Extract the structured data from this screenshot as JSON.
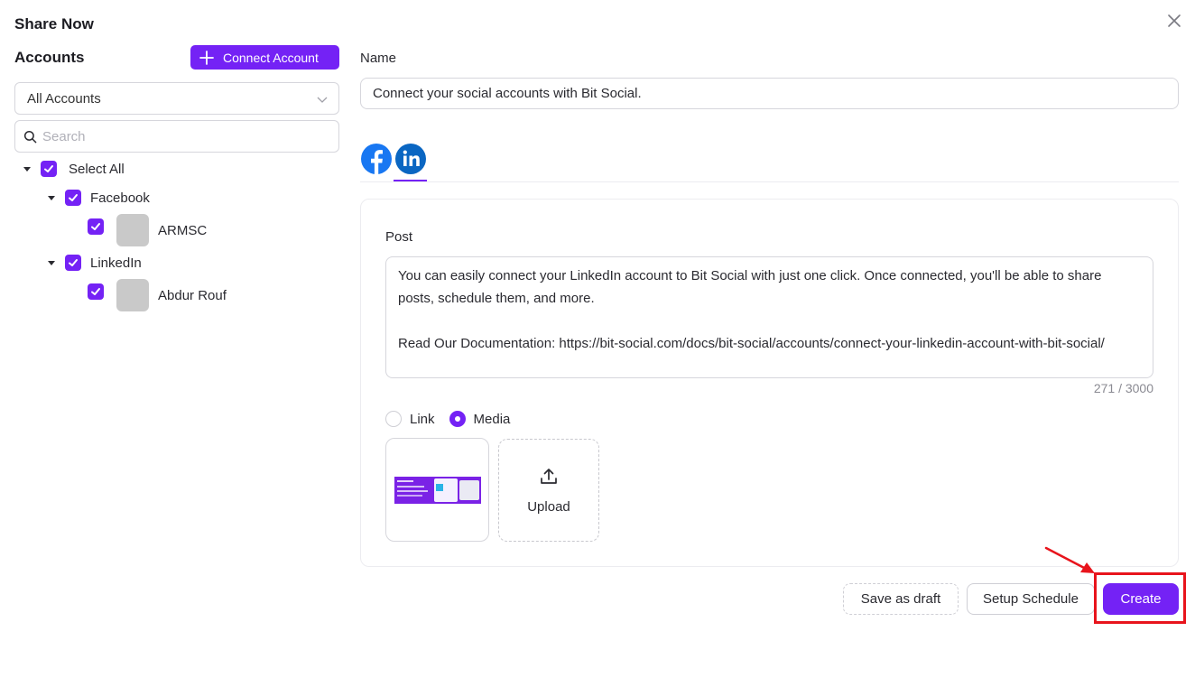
{
  "modal": {
    "title": "Share Now"
  },
  "accounts": {
    "heading": "Accounts",
    "connect_label": "Connect Account",
    "filter_value": "All Accounts",
    "search_placeholder": "Search",
    "select_all_label": "Select All",
    "groups": [
      {
        "label": "Facebook",
        "items": [
          {
            "label": "ARMSC"
          }
        ]
      },
      {
        "label": "LinkedIn",
        "items": [
          {
            "label": "Abdur Rouf"
          }
        ]
      }
    ]
  },
  "form": {
    "name_label": "Name",
    "name_value": "Connect your social accounts with Bit Social.",
    "post_label": "Post",
    "post_text": "You can easily connect your LinkedIn account to Bit Social with just one click. Once connected, you'll be able to share posts, schedule them, and more.\n\nRead Our Documentation: https://bit-social.com/docs/bit-social/accounts/connect-your-linkedin-account-with-bit-social/",
    "char_count": "271 / 3000",
    "radio_link": "Link",
    "radio_media": "Media",
    "upload_label": "Upload"
  },
  "footer": {
    "draft_label": "Save as draft",
    "schedule_label": "Setup Schedule",
    "create_label": "Create"
  },
  "icons": {
    "close": "close-icon",
    "plus": "plus-icon",
    "chevron": "chevron-down-icon",
    "search": "search-icon",
    "facebook": "facebook-icon",
    "linkedin": "linkedin-icon",
    "upload": "upload-icon"
  },
  "colors": {
    "accent": "#7422f5",
    "highlight": "#e8141c",
    "facebook": "#1877f2",
    "linkedin": "#0a66c2"
  }
}
